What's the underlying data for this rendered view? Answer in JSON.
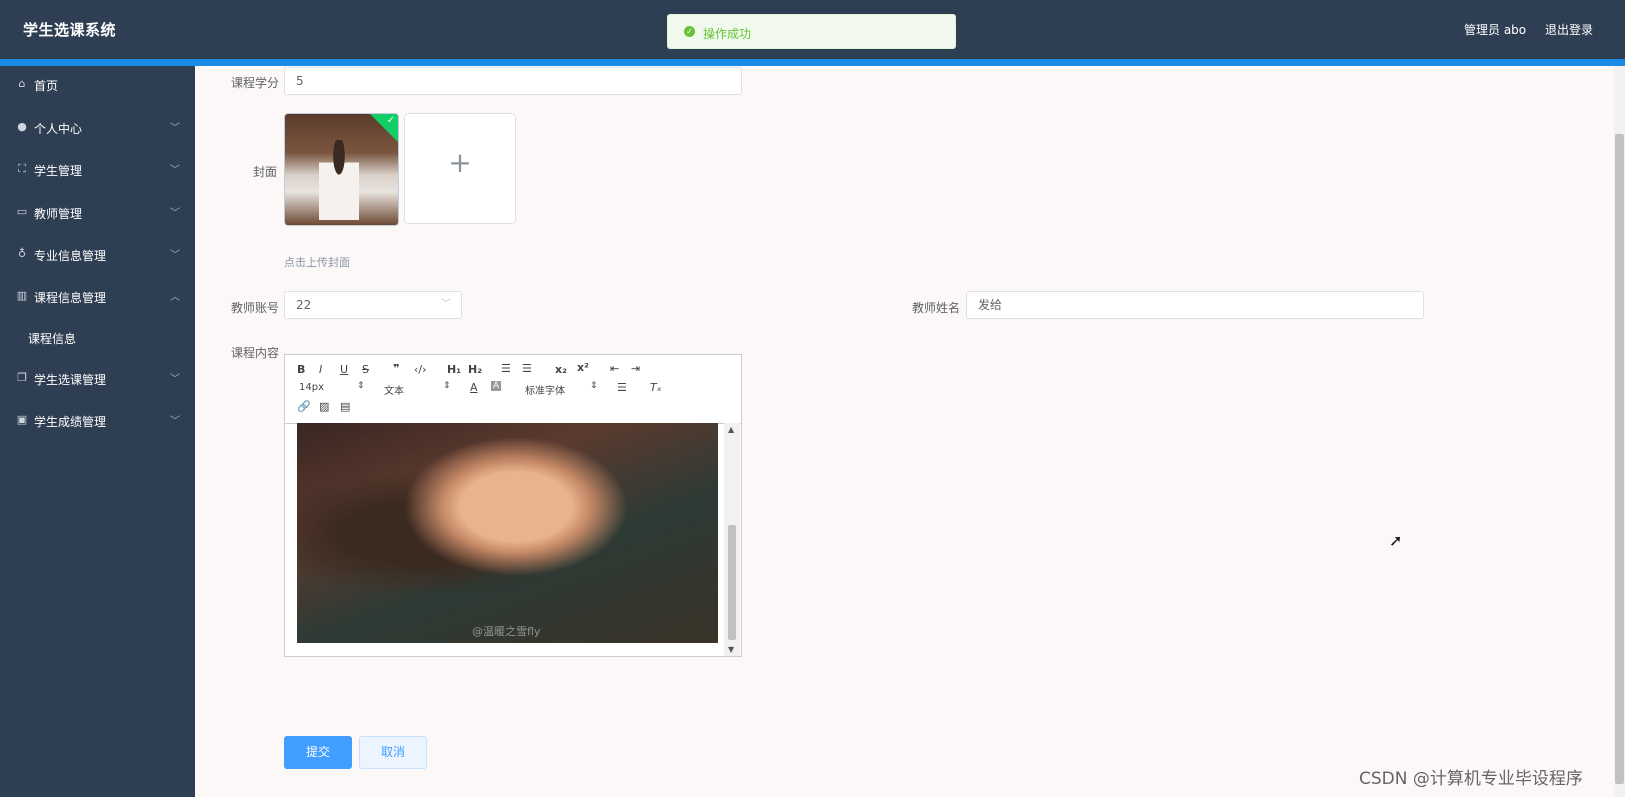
{
  "app": {
    "title": "学生选课系统"
  },
  "header": {
    "admin": "管理员 abo",
    "logout": "退出登录"
  },
  "toast": {
    "message": "操作成功",
    "color": "#67c23a"
  },
  "colors": {
    "header_bg": "#2f3f53",
    "accent": "#1a8ce8",
    "primary": "#409eff"
  },
  "sidebar": {
    "items": [
      {
        "label": "首页",
        "icon": "home-icon"
      },
      {
        "label": "个人中心",
        "icon": "user-icon"
      },
      {
        "label": "学生管理",
        "icon": "frame-icon"
      },
      {
        "label": "教师管理",
        "icon": "chat-icon"
      },
      {
        "label": "专业信息管理",
        "icon": "mic-icon"
      },
      {
        "label": "课程信息管理",
        "icon": "chart-icon"
      },
      {
        "label": "课程信息",
        "icon": ""
      },
      {
        "label": "学生选课管理",
        "icon": "copy-icon"
      },
      {
        "label": "学生成绩管理",
        "icon": "briefcase-icon"
      }
    ]
  },
  "form": {
    "credit_label": "课程学分",
    "credit_value": "5",
    "cover_label": "封面",
    "upload_hint": "点击上传封面",
    "teacher_account_label": "教师账号",
    "teacher_account_value": "22",
    "teacher_name_label": "教师姓名",
    "teacher_name_value": "发给",
    "content_label": "课程内容"
  },
  "editor": {
    "font_size": "14px",
    "text_type": "文本",
    "font_family": "标准字体",
    "image_watermark": "@温暖之雪fly"
  },
  "buttons": {
    "submit": "提交",
    "cancel": "取消"
  },
  "watermark": "CSDN @计算机专业毕设程序"
}
